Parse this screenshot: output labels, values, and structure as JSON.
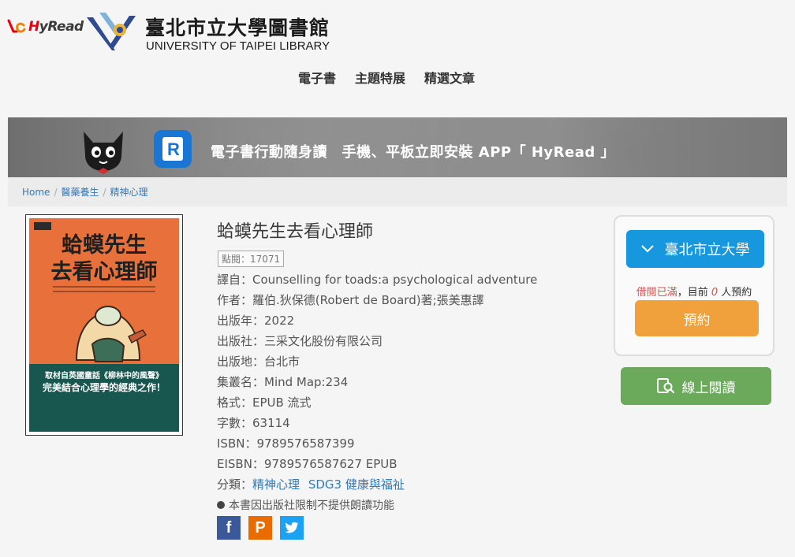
{
  "header": {
    "hyread_logo": "HyRead",
    "library_name_zh": "臺北市立大學圖書館",
    "library_name_en": "UNIVERSITY OF TAIPEI LIBRARY"
  },
  "nav": [
    "電子書",
    "主題特展",
    "精選文章"
  ],
  "banner": {
    "text": "電子書行動隨身讀　手機、平板立即安裝 APP「 HyRead 」"
  },
  "breadcrumb": [
    "Home",
    "醫藥養生",
    "精神心理"
  ],
  "cover": {
    "title_line1": "蛤蟆先生",
    "title_line2": "去看心理師",
    "tagline1": "取材自英國童話《柳林中的風聲》",
    "tagline2": "完美結合心理學的經典之作！"
  },
  "book": {
    "title": "蛤蟆先生去看心理師",
    "views": "點閱：17071",
    "translated_from": "譯自：Counselling for toads:a psychological adventure",
    "author": "作者：羅伯.狄保德(Robert de Board)著;張美惠譯",
    "year": "出版年：2022",
    "publisher": "出版社：三采文化股份有限公司",
    "place": "出版地：台北市",
    "series": "集叢名：Mind Map:234",
    "format": "格式：EPUB 流式",
    "word_count": "字數：63114",
    "isbn": "ISBN：9789576587399",
    "eisbn": "EISBN：9789576587627 EPUB",
    "category_label": "分類：",
    "categories": [
      "精神心理",
      "SDG3 健康與福祉"
    ],
    "notice": "本書因出版社限制不提供朗讀功能"
  },
  "panel": {
    "library_button": "臺北市立大學",
    "status_red": "借閱已滿",
    "status_mid": "，目前 ",
    "status_count": "0",
    "status_tail": " 人預約",
    "reserve_button": "預約",
    "read_online_button": "線上閱讀"
  },
  "share": {
    "facebook": "f",
    "plurk": "P"
  },
  "colors": {
    "link": "#337ab7",
    "primary_blue": "#1697de",
    "reserve_orange": "#f0a13c",
    "read_green": "#6aaa5a",
    "status_red": "#d9534f"
  }
}
